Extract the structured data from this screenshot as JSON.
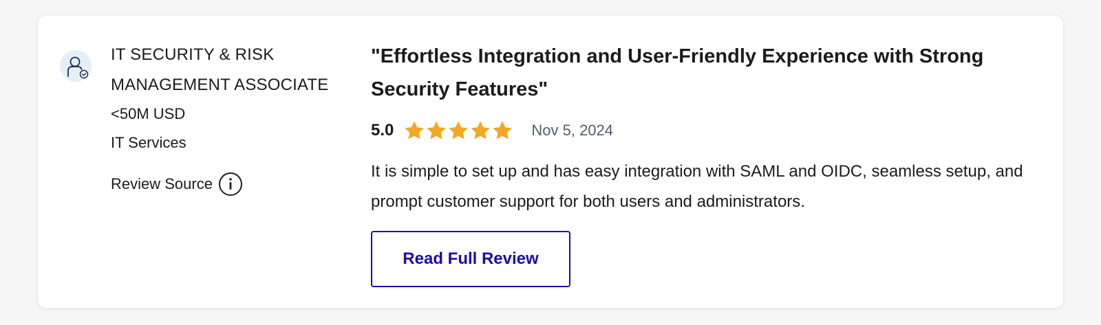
{
  "reviewer": {
    "avatar_icon": "user-check-icon",
    "role_line1": "IT SECURITY & RISK",
    "role_line2": "MANAGEMENT ASSOCIATE",
    "company_size": "<50M USD",
    "industry": "IT Services",
    "review_source_label": "Review Source",
    "info_icon": "info-icon"
  },
  "review": {
    "title": "\"Effortless Integration and User-Friendly Experience with Strong Security Features\"",
    "rating": "5.0",
    "stars_filled": 5,
    "stars_total": 5,
    "date": "Nov 5, 2024",
    "body": "It is simple to set up and has easy integration with SAML and OIDC, seamless setup, and prompt customer support for both users and administrators.",
    "read_button_label": "Read Full Review"
  },
  "colors": {
    "star": "#f5a623",
    "link": "#1a0dab",
    "date": "#4e5d70",
    "avatar_bg": "#e3f0fb"
  }
}
